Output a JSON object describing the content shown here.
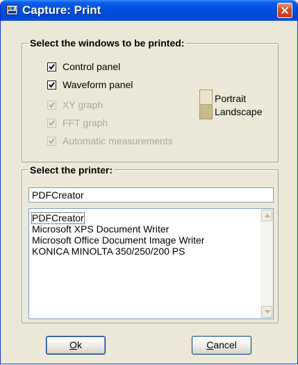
{
  "window": {
    "title": "Capture: Print"
  },
  "windows_group": {
    "title": "Select the windows to be printed:",
    "options": [
      {
        "label": "Control panel",
        "checked": true,
        "enabled": true
      },
      {
        "label": "Waveform panel",
        "checked": true,
        "enabled": true
      },
      {
        "label": "XY graph",
        "checked": true,
        "enabled": false
      },
      {
        "label": "FFT graph",
        "checked": true,
        "enabled": false
      },
      {
        "label": "Automatic measurements",
        "checked": true,
        "enabled": false
      }
    ],
    "orientation": {
      "portrait_label": "Portrait",
      "landscape_label": "Landscape",
      "selected": "Landscape"
    }
  },
  "printer_group": {
    "title": "Select the printer:",
    "input_value": "PDFCreator",
    "printers": [
      "PDFCreator",
      "Microsoft XPS Document Writer",
      "Microsoft Office Document Image Writer",
      "KONICA MINOLTA 350/250/200 PS"
    ],
    "selected_printer": "PDFCreator"
  },
  "buttons": {
    "ok_accel": "O",
    "ok_rest": "k",
    "cancel_accel": "C",
    "cancel_rest": "ancel"
  },
  "colors": {
    "titlebar": "#0052e0",
    "dialog_bg": "#ece9d8",
    "disabled_text": "#aca899"
  }
}
